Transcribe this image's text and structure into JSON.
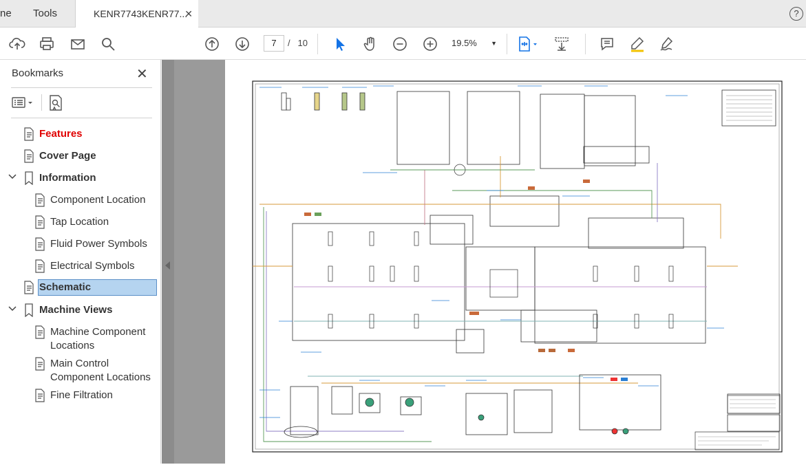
{
  "tabs": {
    "home_label": "ne",
    "tools_label": "Tools",
    "document_label": "KENR7743KENR77...",
    "close_glyph": "✕"
  },
  "help_glyph": "?",
  "toolbar": {
    "current_page": "7",
    "page_separator": "/",
    "total_pages": "10",
    "zoom": "19.5%"
  },
  "bookmarks": {
    "title": "Bookmarks",
    "items": [
      {
        "label": "Features",
        "level": 1,
        "color": "#e00000"
      },
      {
        "label": "Cover Page",
        "level": 1
      },
      {
        "label": "Information",
        "level": 1,
        "expanded": true
      },
      {
        "label": "Component Location",
        "level": 2
      },
      {
        "label": "Tap Location",
        "level": 2
      },
      {
        "label": "Fluid Power Symbols",
        "level": 2
      },
      {
        "label": "Electrical Symbols",
        "level": 2
      },
      {
        "label": "Schematic",
        "level": 1,
        "selected": true
      },
      {
        "label": "Machine Views",
        "level": 1,
        "expanded": true
      },
      {
        "label": "Machine Component Locations",
        "level": 2
      },
      {
        "label": "Main Control Component Locations",
        "level": 2
      },
      {
        "label": "Fine Filtration",
        "level": 2
      }
    ]
  },
  "colors": {
    "selected_bg": "#b5d4f0",
    "accent_blue": "#1473e6",
    "features_red": "#e00000"
  }
}
